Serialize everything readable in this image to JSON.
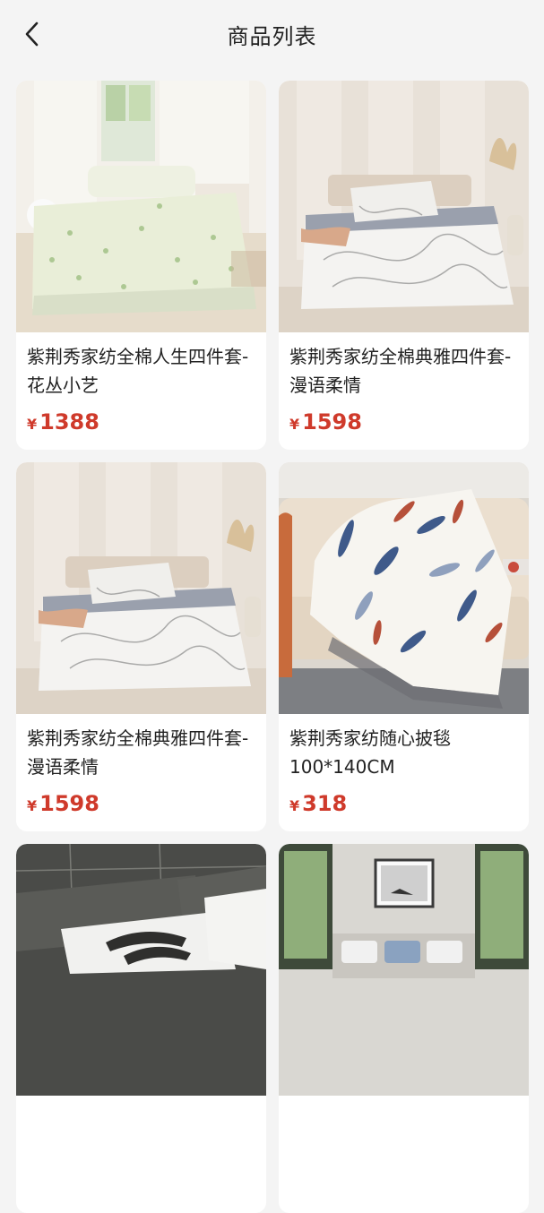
{
  "header": {
    "title": "商品列表",
    "back_icon": "chevron-left-icon"
  },
  "currency": "¥",
  "products": [
    {
      "name": "紫荆秀家纺全棉人生四件套-花丛小艺",
      "price": "1388",
      "image": "floral-bedding-photo"
    },
    {
      "name": "紫荆秀家纺全棉典雅四件套-漫语柔情",
      "price": "1598",
      "image": "marble-bedding-photo"
    },
    {
      "name": "紫荆秀家纺全棉典雅四件套-漫语柔情",
      "price": "1598",
      "image": "marble-bedding-photo"
    },
    {
      "name": "紫荆秀家纺随心披毯100*140CM",
      "price": "318",
      "image": "feather-blanket-photo"
    },
    {
      "name": "",
      "price": "",
      "image": "gray-plaid-bedding-photo"
    },
    {
      "name": "",
      "price": "",
      "image": "bedroom-window-photo"
    }
  ]
}
